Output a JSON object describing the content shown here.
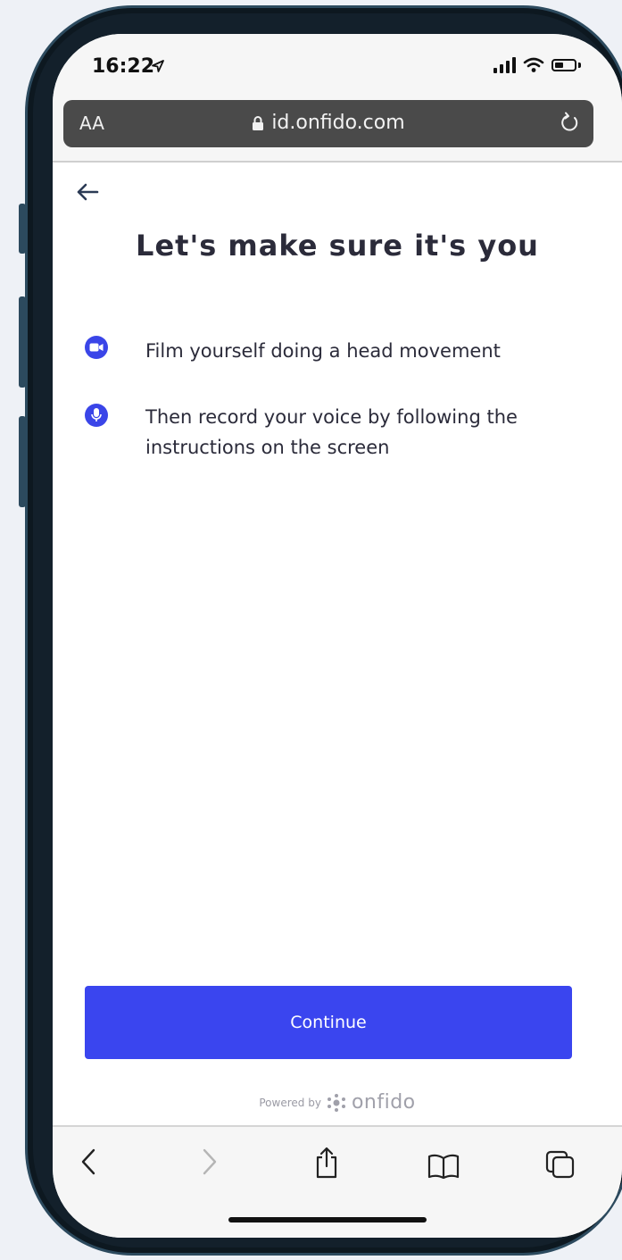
{
  "status_bar": {
    "time": "16:22"
  },
  "browser": {
    "text_size_label": "AA",
    "url": "id.onfido.com"
  },
  "page": {
    "title": "Let's make sure it's you",
    "items": [
      {
        "icon": "video-camera-icon",
        "text": "Film yourself doing a head movement"
      },
      {
        "icon": "microphone-icon",
        "text": "Then record your voice by following the instructions on the screen"
      }
    ],
    "continue_label": "Continue",
    "powered_by": "Powered by",
    "brand": "onfido"
  },
  "colors": {
    "accent": "#3a45ef",
    "text": "#2b2b3a"
  }
}
